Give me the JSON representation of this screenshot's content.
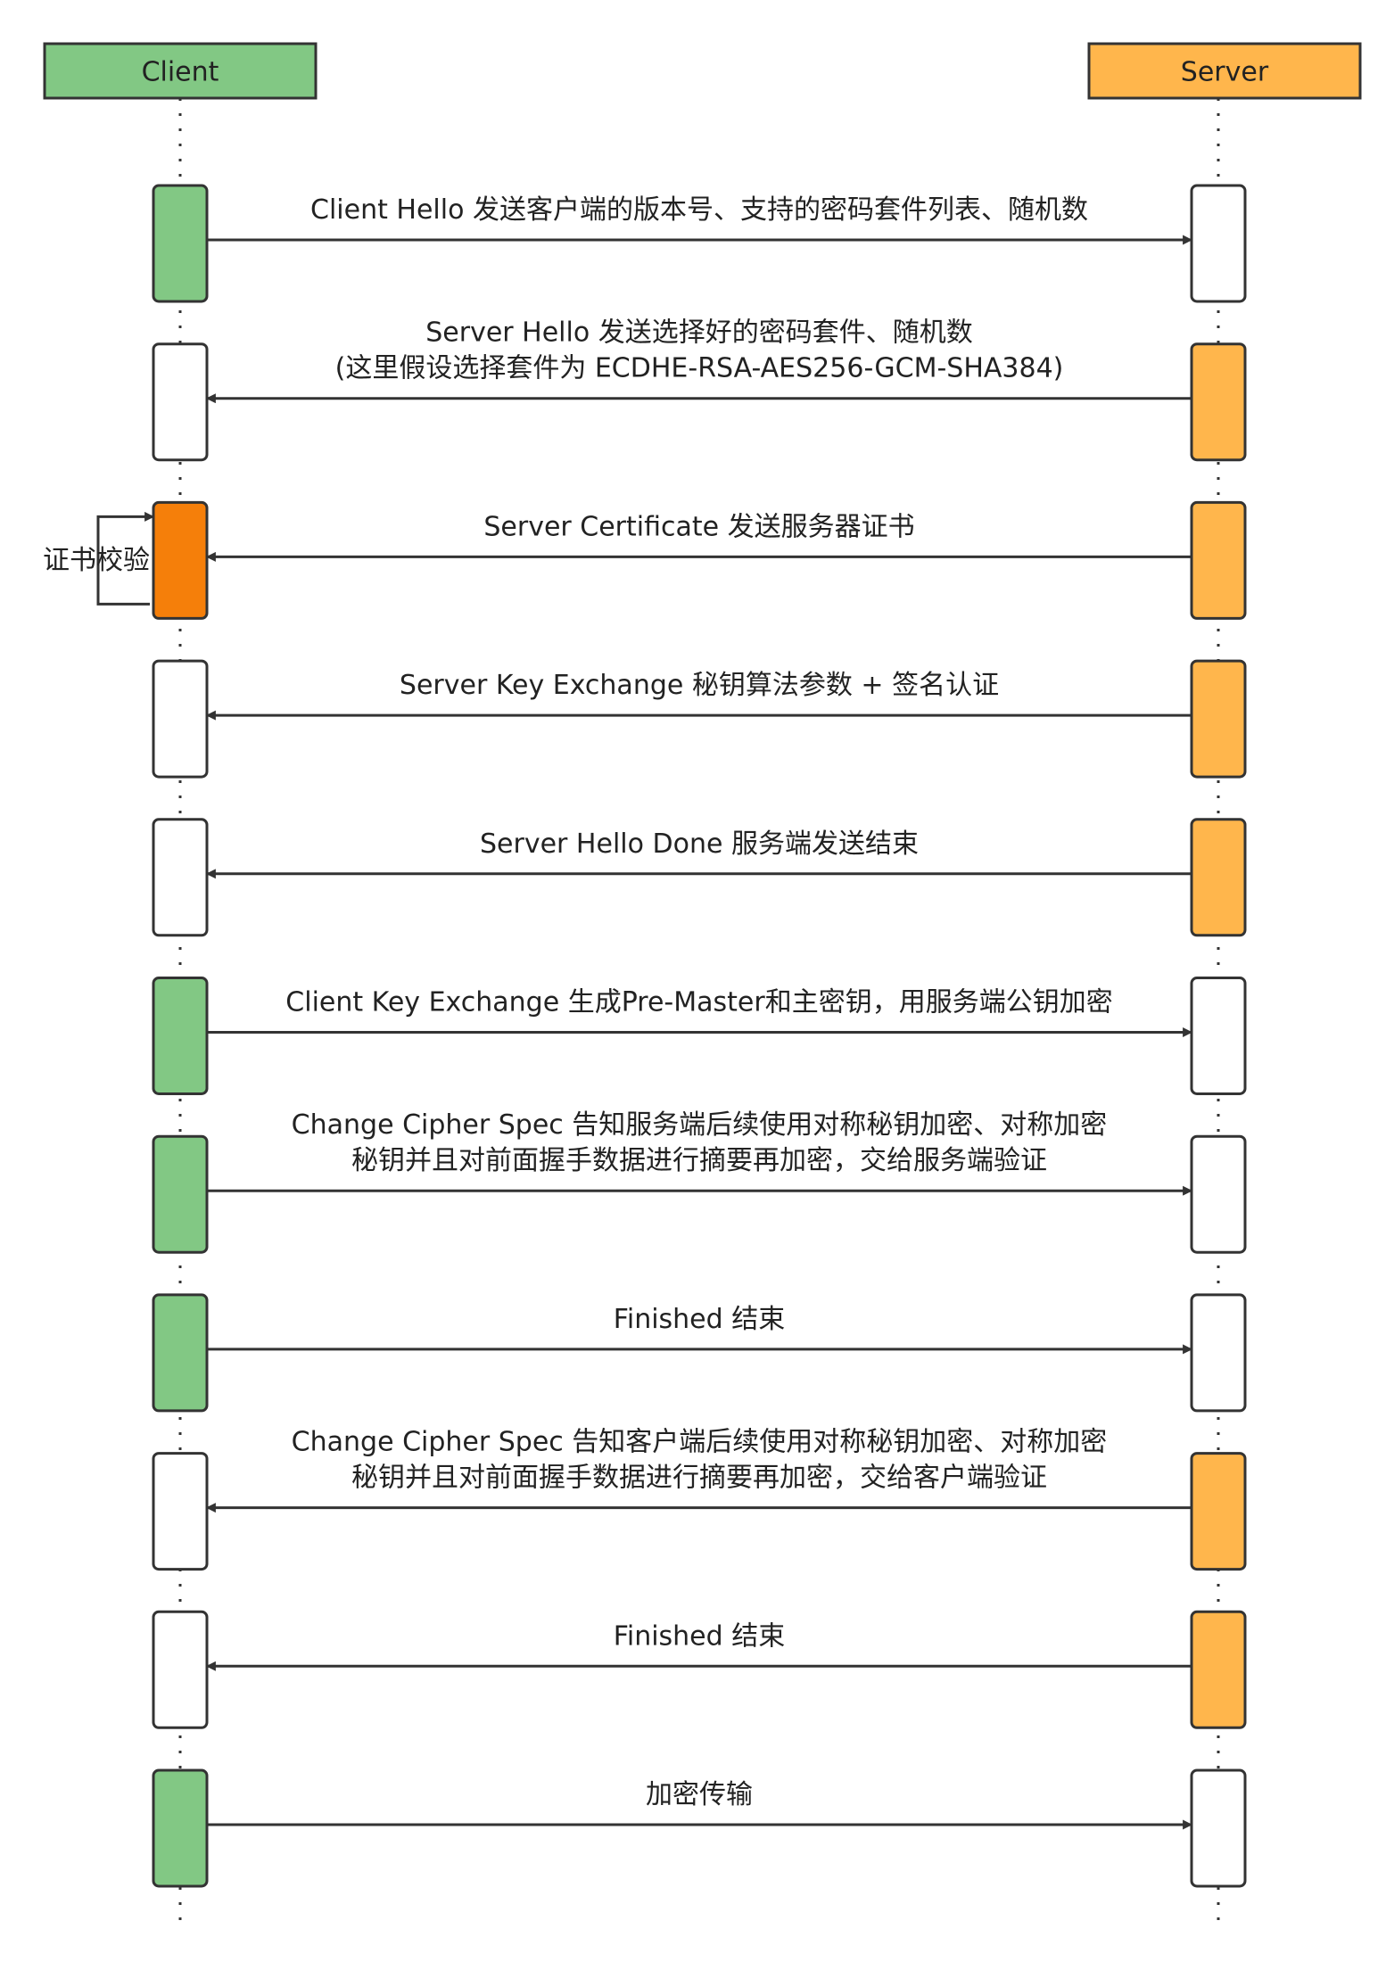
{
  "actors": {
    "client": {
      "label": "Client",
      "color": "#82c884"
    },
    "server": {
      "label": "Server",
      "color": "#ffb64c"
    }
  },
  "colors": {
    "client_active": "#82c884",
    "server_active": "#ffb64c",
    "verify_active": "#f57f0a",
    "inactive": "#ffffff",
    "line": "#333333"
  },
  "messages": [
    {
      "direction": "client-to-server",
      "lines": [
        "Client Hello  发送客户端的版本号、支持的密码套件列表、随机数"
      ]
    },
    {
      "direction": "server-to-client",
      "lines": [
        "Server Hello  发送选择好的密码套件、随机数",
        "(这里假设选择套件为 ECDHE-RSA-AES256-GCM-SHA384)"
      ]
    },
    {
      "direction": "server-to-client",
      "lines": [
        "Server Certificate  发送服务器证书"
      ],
      "self_note": "证书校验"
    },
    {
      "direction": "server-to-client",
      "lines": [
        "Server Key Exchange  秘钥算法参数 + 签名认证"
      ]
    },
    {
      "direction": "server-to-client",
      "lines": [
        "Server Hello Done  服务端发送结束"
      ]
    },
    {
      "direction": "client-to-server",
      "lines": [
        "Client Key Exchange  生成Pre-Master和主密钥，用服务端公钥加密"
      ]
    },
    {
      "direction": "client-to-server",
      "lines": [
        "Change Cipher Spec  告知服务端后续使用对称秘钥加密、对称加密",
        "秘钥并且对前面握手数据进行摘要再加密，交给服务端验证"
      ]
    },
    {
      "direction": "client-to-server",
      "lines": [
        "Finished  结束"
      ]
    },
    {
      "direction": "server-to-client",
      "lines": [
        "Change Cipher Spec  告知客户端后续使用对称秘钥加密、对称加密",
        "秘钥并且对前面握手数据进行摘要再加密，交给客户端验证"
      ]
    },
    {
      "direction": "server-to-client",
      "lines": [
        "Finished  结束"
      ]
    },
    {
      "direction": "client-to-server",
      "lines": [
        "加密传输"
      ]
    }
  ]
}
